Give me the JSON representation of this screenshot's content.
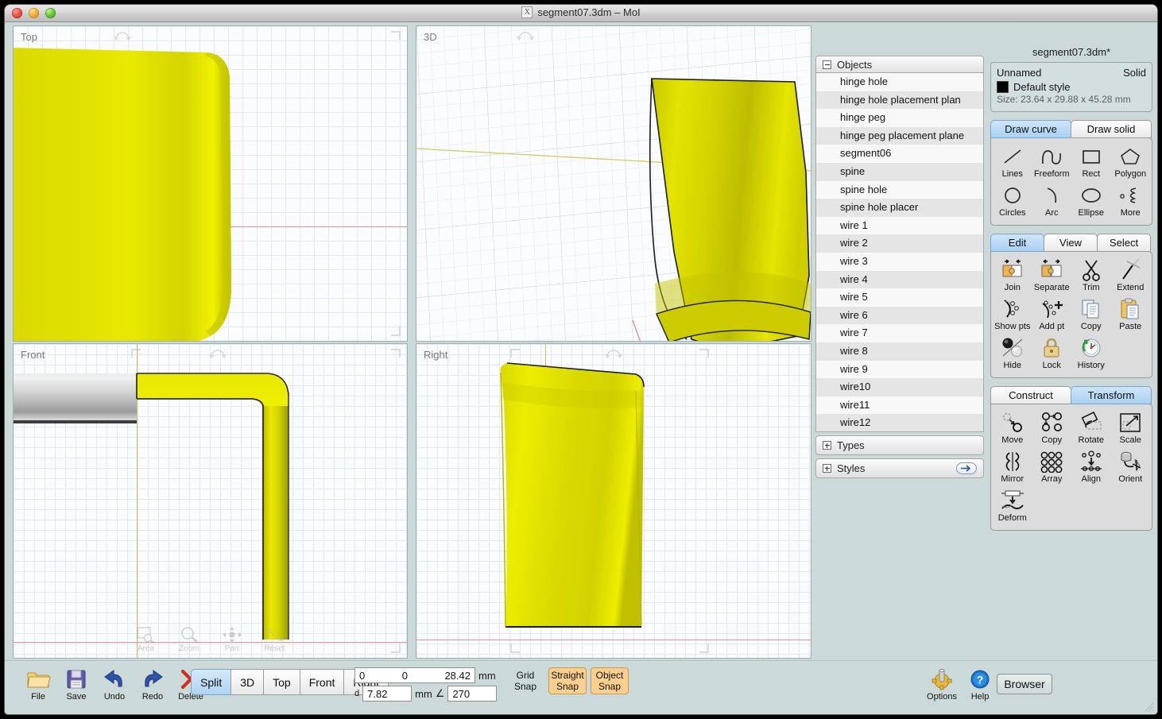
{
  "window": {
    "title": "segment07.3dm – MoI",
    "title_icon": "x-icon",
    "controls": [
      "close",
      "minimize",
      "zoom"
    ]
  },
  "viewports": [
    {
      "name": "Top",
      "label": "Top"
    },
    {
      "name": "3D",
      "label": "3D"
    },
    {
      "name": "Front",
      "label": "Front"
    },
    {
      "name": "Right",
      "label": "Right"
    }
  ],
  "viewport_nav": [
    {
      "label": "Area",
      "icon": "area-zoom-icon"
    },
    {
      "label": "Zoom",
      "icon": "magnifier-icon"
    },
    {
      "label": "Pan",
      "icon": "pan-arrows-icon"
    },
    {
      "label": "Reset",
      "icon": "reset-icon"
    }
  ],
  "browser": {
    "objects_header": "Objects",
    "objects": [
      "hinge hole",
      "hinge hole placement plan",
      "hinge peg",
      "hinge peg placement plane",
      "segment06",
      "spine",
      "spine hole",
      "spine hole placer",
      "wire 1",
      "wire 2",
      "wire 3",
      "wire 4",
      "wire 5",
      "wire 6",
      "wire 7",
      "wire 8",
      "wire 9",
      "wire10",
      "wire11",
      "wire12"
    ],
    "types_header": "Types",
    "styles_header": "Styles"
  },
  "properties": {
    "document_title": "segment07.3dm*",
    "object_name": "Unnamed",
    "object_type": "Solid",
    "style_name": "Default style",
    "style_color": "#000000",
    "size": "Size: 23.64 x 29.88 x 45.28 mm"
  },
  "draw_panel": {
    "tabs": [
      {
        "label": "Draw curve",
        "active": true
      },
      {
        "label": "Draw solid",
        "active": false
      }
    ],
    "tools": [
      {
        "label": "Lines",
        "icon": "line-icon"
      },
      {
        "label": "Freeform",
        "icon": "freeform-curve-icon"
      },
      {
        "label": "Rect",
        "icon": "rectangle-icon"
      },
      {
        "label": "Polygon",
        "icon": "polygon-icon"
      },
      {
        "label": "Circles",
        "icon": "circle-icon"
      },
      {
        "label": "Arc",
        "icon": "arc-icon"
      },
      {
        "label": "Ellipse",
        "icon": "ellipse-icon"
      },
      {
        "label": "More",
        "icon": "helix-more-icon"
      }
    ]
  },
  "edit_panel": {
    "tabs": [
      {
        "label": "Edit",
        "active": true
      },
      {
        "label": "View",
        "active": false
      },
      {
        "label": "Select",
        "active": false
      }
    ],
    "tools": [
      {
        "label": "Join",
        "icon": "join-icon"
      },
      {
        "label": "Separate",
        "icon": "separate-icon"
      },
      {
        "label": "Trim",
        "icon": "scissors-icon"
      },
      {
        "label": "Extend",
        "icon": "extend-icon"
      },
      {
        "label": "Show pts",
        "icon": "show-points-icon"
      },
      {
        "label": "Add pt",
        "icon": "add-point-icon"
      },
      {
        "label": "Copy",
        "icon": "copy-icon"
      },
      {
        "label": "Paste",
        "icon": "paste-icon"
      },
      {
        "label": "Hide",
        "icon": "hide-sphere-icon"
      },
      {
        "label": "Lock",
        "icon": "padlock-icon"
      },
      {
        "label": "History",
        "icon": "history-clock-icon"
      }
    ]
  },
  "transform_panel": {
    "tabs": [
      {
        "label": "Construct",
        "active": false
      },
      {
        "label": "Transform",
        "active": true
      }
    ],
    "tools": [
      {
        "label": "Move",
        "icon": "move-icon"
      },
      {
        "label": "Copy",
        "icon": "copy-objects-icon"
      },
      {
        "label": "Rotate",
        "icon": "rotate-icon"
      },
      {
        "label": "Scale",
        "icon": "scale-icon"
      },
      {
        "label": "Mirror",
        "icon": "mirror-icon"
      },
      {
        "label": "Array",
        "icon": "array-grid-icon"
      },
      {
        "label": "Align",
        "icon": "align-icon"
      },
      {
        "label": "Orient",
        "icon": "orient-icon"
      },
      {
        "label": "Deform",
        "icon": "deform-icon"
      }
    ]
  },
  "bottom_toolbar": {
    "actions": [
      {
        "label": "File",
        "icon": "folder-icon"
      },
      {
        "label": "Save",
        "icon": "floppy-disk-icon"
      },
      {
        "label": "Undo",
        "icon": "undo-arrow-icon"
      },
      {
        "label": "Redo",
        "icon": "redo-arrow-icon"
      },
      {
        "label": "Delete",
        "icon": "x-delete-icon"
      }
    ],
    "view_buttons": [
      {
        "label": "Split",
        "active": true
      },
      {
        "label": "3D",
        "active": false
      },
      {
        "label": "Top",
        "active": false
      },
      {
        "label": "Front",
        "active": false
      },
      {
        "label": "Right",
        "active": false
      }
    ],
    "coords": {
      "x": "0",
      "y": "0",
      "z": "28.42",
      "unit": "mm",
      "distance_label": "d",
      "distance": "7.82",
      "distance_unit": "mm",
      "angle_symbol": "∠",
      "angle": "270"
    },
    "snaps": [
      {
        "label": "Grid\nSnap",
        "line1": "Grid",
        "line2": "Snap",
        "active": false
      },
      {
        "label": "Straight Snap",
        "line1": "Straight",
        "line2": "Snap",
        "active": true
      },
      {
        "label": "Object Snap",
        "line1": "Object",
        "line2": "Snap",
        "active": true
      }
    ],
    "right_actions": [
      {
        "label": "Options",
        "icon": "gear-options-icon"
      },
      {
        "label": "Help",
        "icon": "question-help-icon"
      }
    ],
    "browser_button": "Browser"
  },
  "colors": {
    "app_background": "#ccd9d9",
    "viewport_background": "#fbfcff",
    "grid_minor": "#e3e9f2",
    "grid_major": "#cfd7e4",
    "axis_x": "#e89090",
    "axis_y": "#c8c84a",
    "model_yellow": "#d9d900",
    "snap_active": "#fbcf8e",
    "tab_active": "#aed4f5"
  }
}
